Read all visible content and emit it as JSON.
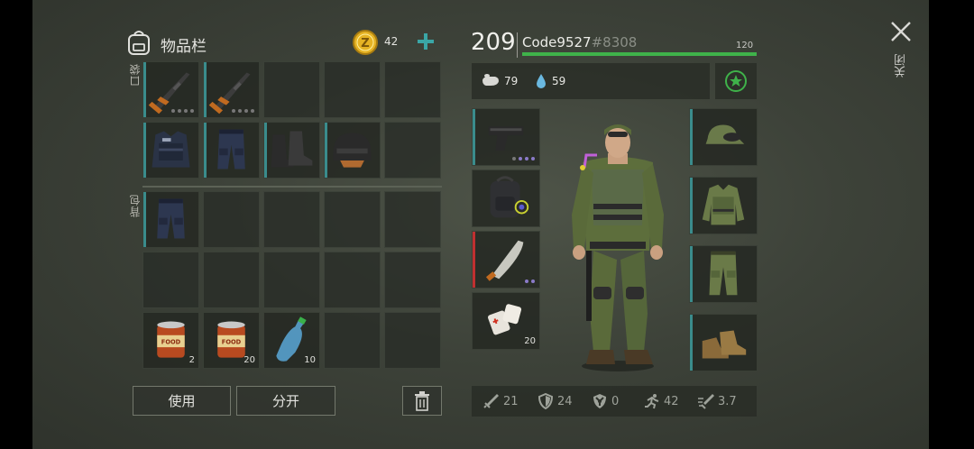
{
  "inventory": {
    "title": "物品栏",
    "coins": "42",
    "pockets_label": "口袋",
    "backpack_label": "背包",
    "pocket_slots": [
      {
        "item": "rifle-icon",
        "qty": ""
      },
      {
        "item": "rifle-icon",
        "qty": ""
      },
      {
        "item": "",
        "qty": ""
      },
      {
        "item": "",
        "qty": ""
      },
      {
        "item": "",
        "qty": ""
      },
      {
        "item": "police-vest-icon",
        "qty": ""
      },
      {
        "item": "police-pants-icon",
        "qty": ""
      },
      {
        "item": "boots-icon",
        "qty": ""
      },
      {
        "item": "helmet-icon",
        "qty": ""
      },
      {
        "item": "",
        "qty": ""
      }
    ],
    "backpack_slots": [
      {
        "item": "police-pants-icon",
        "qty": ""
      },
      {
        "item": "",
        "qty": ""
      },
      {
        "item": "",
        "qty": ""
      },
      {
        "item": "",
        "qty": ""
      },
      {
        "item": "",
        "qty": ""
      },
      {
        "item": "",
        "qty": ""
      },
      {
        "item": "",
        "qty": ""
      },
      {
        "item": "",
        "qty": ""
      },
      {
        "item": "",
        "qty": ""
      },
      {
        "item": "",
        "qty": ""
      },
      {
        "item": "canned-food-icon",
        "qty": "2"
      },
      {
        "item": "canned-food-icon",
        "qty": "20"
      },
      {
        "item": "water-bottle-icon",
        "qty": "10"
      },
      {
        "item": "",
        "qty": ""
      },
      {
        "item": "",
        "qty": ""
      }
    ],
    "use_label": "使用",
    "split_label": "分开"
  },
  "character": {
    "level": "209",
    "name": "Code9527",
    "tag": "#8308",
    "xp_max": "120",
    "xp_fraction": 1.0,
    "hunger": "79",
    "thirst": "59",
    "equipment_left": [
      {
        "item": "pistol-icon",
        "qty": ""
      },
      {
        "item": "backpack-icon",
        "qty": ""
      },
      {
        "item": "machete-icon",
        "qty": ""
      },
      {
        "item": "bandage-icon",
        "qty": "20"
      }
    ],
    "equipment_right": [
      {
        "item": "camo-cap-icon"
      },
      {
        "item": "camo-jacket-icon"
      },
      {
        "item": "camo-pants-icon"
      },
      {
        "item": "leather-boots-icon"
      }
    ],
    "stats": {
      "damage": "21",
      "defense": "24",
      "radiation": "0",
      "speed": "42",
      "attack_speed": "3.7"
    }
  },
  "close_label": "关闭",
  "colors": {
    "accent_teal": "#3a8c8c",
    "xp_green": "#3fb24a",
    "coin_gold": "#e6b324"
  }
}
